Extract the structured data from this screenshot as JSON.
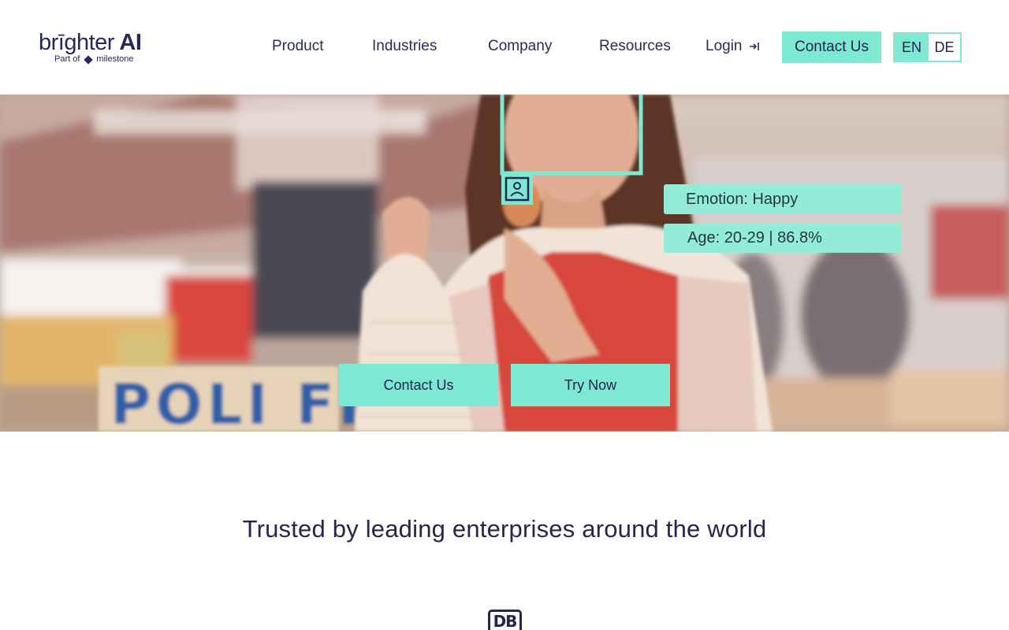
{
  "logo": {
    "brand_light": "brīghter",
    "brand_bold": " AI",
    "sub_prefix": "Part of",
    "sub_name": "milestone"
  },
  "nav": {
    "product": "Product",
    "industries": "Industries",
    "company": "Company",
    "resources": "Resources",
    "login": "Login",
    "login_icon": "login-arrow-icon",
    "contact": "Contact Us"
  },
  "language": {
    "options": [
      "EN",
      "DE"
    ],
    "selected": "EN"
  },
  "hero": {
    "emotion_label": "Emotion: Happy",
    "age_label": "Age: 20-29 | 86.8%",
    "sign_text": "POLI FF",
    "contact_button": "Contact Us",
    "try_button": "Try Now",
    "profile_icon": "person-id-icon"
  },
  "trusted": {
    "heading": "Trusted by leading enterprises around the world",
    "first_logo": "DB"
  },
  "colors": {
    "accent": "#7de9d2",
    "tag": "#93ecd8",
    "text_dark": "#24264f"
  }
}
